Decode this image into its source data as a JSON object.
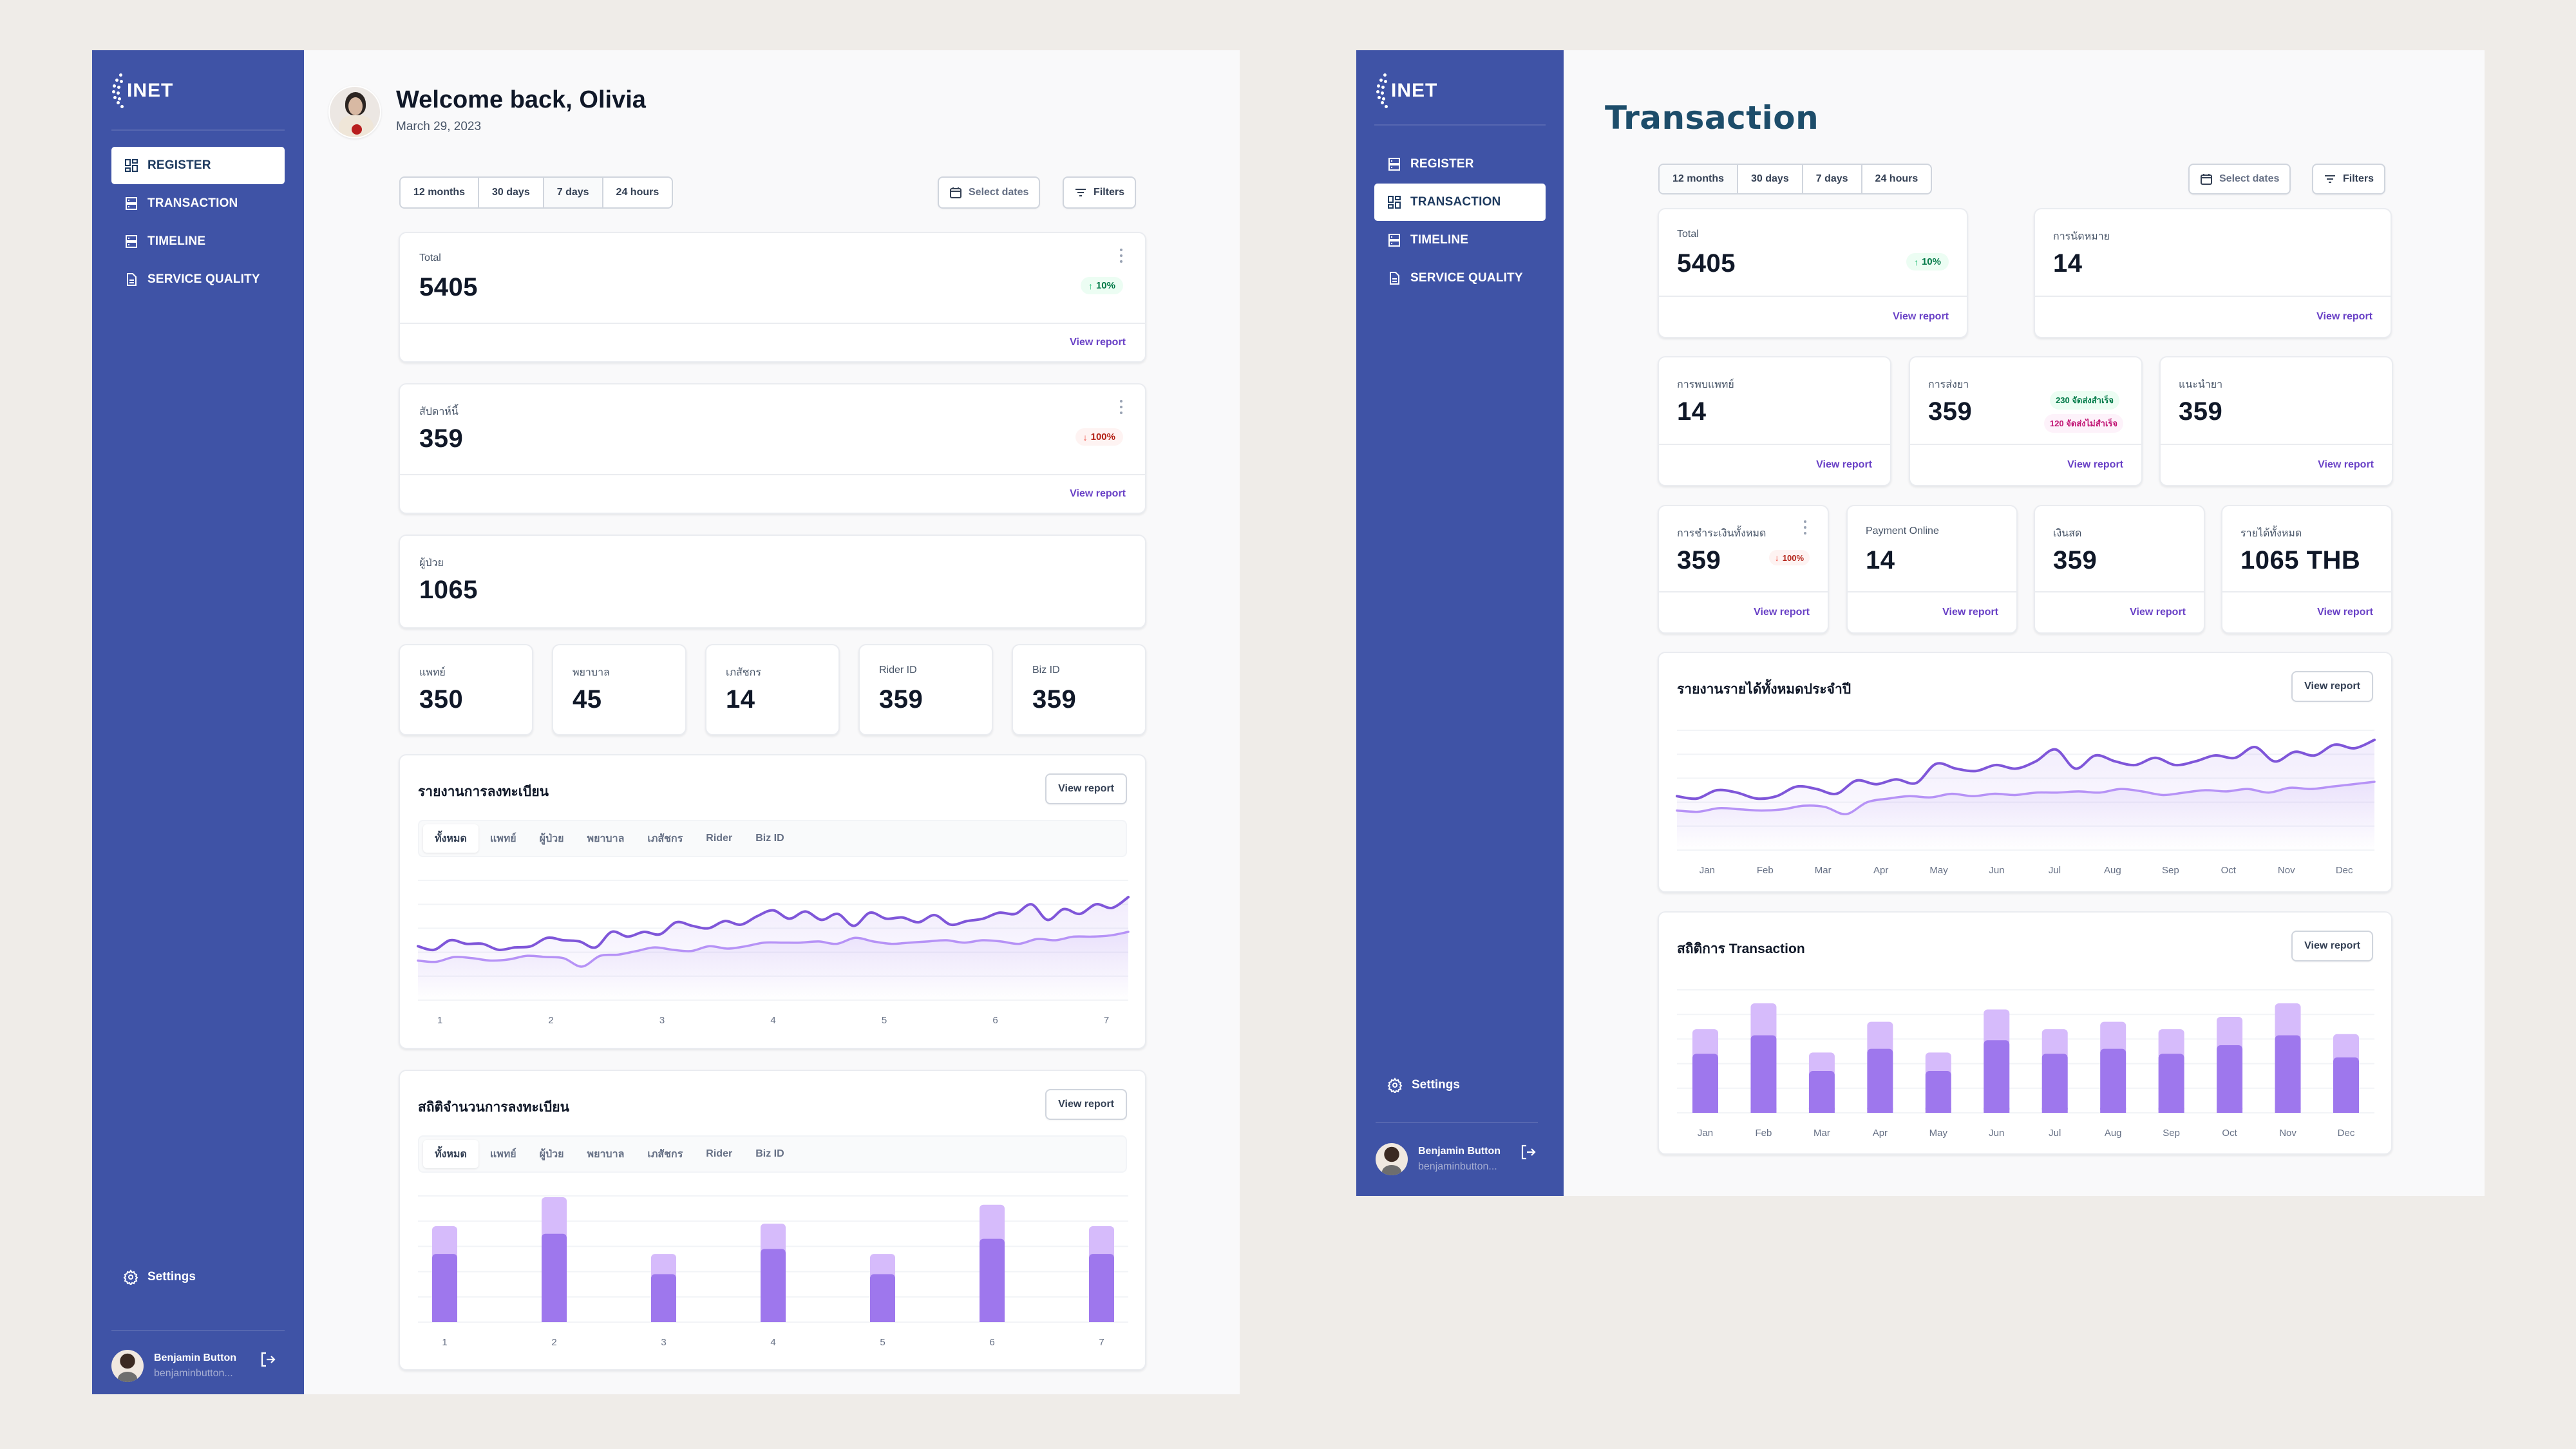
{
  "brand": {
    "logo_text": "INET",
    "sidebar_color": "#3F53A6",
    "accent": "#6941C6"
  },
  "nav": [
    {
      "label": "REGISTER",
      "icon": "grid-icon"
    },
    {
      "label": "TRANSACTION",
      "icon": "rows-icon"
    },
    {
      "label": "TIMELINE",
      "icon": "rows-icon"
    },
    {
      "label": "SERVICE QUALITY",
      "icon": "document-icon"
    }
  ],
  "settings_label": "Settings",
  "user": {
    "name": "Benjamin Button",
    "email": "benjaminbutton..."
  },
  "time_ranges": [
    "12 months",
    "30 days",
    "7 days",
    "24 hours"
  ],
  "select_dates_label": "Select dates",
  "filters_label": "Filters",
  "view_report": "View report",
  "register_page": {
    "active_nav": "REGISTER",
    "welcome": "Welcome back, Olivia",
    "date": "March 29, 2023",
    "active_range": "7 days",
    "stats": [
      {
        "label": "Total",
        "value": "5405",
        "badge": "10%",
        "trend": "up"
      },
      {
        "label": "สัปดาห์นี้",
        "value": "359",
        "badge": "100%",
        "trend": "down"
      },
      {
        "label": "ผู้ป่วย",
        "value": "1065"
      }
    ],
    "small_stats": [
      {
        "label": "แพทย์",
        "value": "350"
      },
      {
        "label": "พยาบาล",
        "value": "45"
      },
      {
        "label": "เภสัชกร",
        "value": "14"
      },
      {
        "label": "Rider ID",
        "value": "359"
      },
      {
        "label": "Biz ID",
        "value": "359"
      }
    ],
    "filter_tabs": [
      "ทั้งหมด",
      "แพทย์",
      "ผู้ป่วย",
      "พยาบาล",
      "เภสัชกร",
      "Rider",
      "Biz ID"
    ],
    "active_filter_tab": "ทั้งหมด"
  },
  "transaction_page": {
    "active_nav": "TRANSACTION",
    "title": "Transaction",
    "active_range": "12 months",
    "row1": [
      {
        "label": "Total",
        "value": "5405",
        "badge": "10%",
        "trend": "up"
      },
      {
        "label": "การนัดหมาย",
        "value": "14"
      }
    ],
    "row2": [
      {
        "label": "การพบแพทย์",
        "value": "14"
      },
      {
        "label": "การส่งยา",
        "value": "359",
        "badge_success": "230 จัดส่งสำเร็จ",
        "badge_fail": "120 จัดส่งไม่สำเร็จ"
      },
      {
        "label": "แนะนำยา",
        "value": "359"
      }
    ],
    "row3": [
      {
        "label": "การชำระเงินทั้งหมด",
        "value": "359",
        "badge": "100%",
        "trend": "down"
      },
      {
        "label": "Payment Online",
        "value": "14"
      },
      {
        "label": "เงินสด",
        "value": "359"
      },
      {
        "label": "รายได้ทั้งหมด",
        "value": "1065 THB"
      }
    ]
  },
  "chart_data": [
    {
      "type": "area",
      "title": "รายงานการลงทะเบียน",
      "x_ticks": [
        "1",
        "2",
        "3",
        "4",
        "5",
        "6",
        "7"
      ],
      "ylim": [
        0,
        100
      ],
      "grid": true,
      "series": [
        {
          "name": "primary",
          "color": "#7F56D9",
          "values": [
            45,
            42,
            50,
            47,
            47,
            42,
            44,
            45,
            52,
            50,
            49,
            44,
            57,
            53,
            57,
            55,
            65,
            62,
            60,
            66,
            63,
            70,
            75,
            68,
            74,
            67,
            72,
            62,
            73,
            68,
            69,
            65,
            71,
            63,
            66,
            68,
            73,
            72,
            80,
            67,
            76,
            72,
            80,
            77,
            86
          ]
        },
        {
          "name": "secondary",
          "color": "#B692F6",
          "values": [
            33,
            32,
            36,
            35,
            33,
            34,
            37,
            36,
            35,
            28,
            37,
            38,
            41,
            44,
            42,
            41,
            45,
            43,
            45,
            48,
            48,
            48,
            49,
            47,
            52,
            49,
            47,
            48,
            49,
            50,
            48,
            50,
            49,
            47,
            51,
            50,
            53,
            53,
            54,
            57
          ]
        }
      ]
    },
    {
      "type": "bar",
      "title": "สถิติจำนวนการลงทะเบียน",
      "categories": [
        "1",
        "2",
        "3",
        "4",
        "5",
        "6",
        "7"
      ],
      "ylim": [
        0,
        100
      ],
      "grid": true,
      "series": [
        {
          "name": "base",
          "color": "#9E77ED",
          "values": [
            54,
            70,
            38,
            58,
            38,
            66,
            54
          ]
        },
        {
          "name": "top",
          "color": "#D6BBFB",
          "values": [
            22,
            29,
            16,
            20,
            16,
            27,
            22
          ]
        }
      ]
    },
    {
      "type": "area",
      "title": "รายงานรายได้ทั้งหมดประจำปี",
      "x_ticks": [
        "Jan",
        "Feb",
        "Mar",
        "Apr",
        "May",
        "Jun",
        "Jul",
        "Aug",
        "Sep",
        "Oct",
        "Nov",
        "Dec"
      ],
      "ylim": [
        0,
        100
      ],
      "grid": true,
      "series": [
        {
          "name": "primary",
          "color": "#7F56D9",
          "values": [
            45,
            43,
            50,
            48,
            43,
            45,
            53,
            51,
            47,
            58,
            55,
            59,
            56,
            72,
            68,
            66,
            71,
            68,
            74,
            84,
            68,
            79,
            74,
            71,
            77,
            71,
            74,
            79,
            77,
            86,
            74,
            82,
            79,
            88,
            85,
            92
          ]
        },
        {
          "name": "secondary",
          "color": "#B692F6",
          "values": [
            33,
            32,
            35,
            34,
            33,
            34,
            37,
            36,
            30,
            40,
            43,
            45,
            44,
            47,
            45,
            47,
            46,
            48,
            48,
            49,
            48,
            51,
            49,
            46,
            48,
            50,
            49,
            51,
            48,
            52,
            51,
            53,
            55,
            57
          ]
        }
      ]
    },
    {
      "type": "bar",
      "title": "สถิติการ Transaction",
      "categories": [
        "Jan",
        "Feb",
        "Mar",
        "Apr",
        "May",
        "Jun",
        "Jul",
        "Aug",
        "Sep",
        "Oct",
        "Nov",
        "Dec"
      ],
      "ylim": [
        0,
        100
      ],
      "grid": true,
      "series": [
        {
          "name": "base",
          "color": "#9E77ED",
          "values": [
            48,
            63,
            34,
            52,
            34,
            59,
            48,
            52,
            48,
            55,
            63,
            45
          ]
        },
        {
          "name": "top",
          "color": "#D6BBFB",
          "values": [
            20,
            26,
            15,
            22,
            15,
            25,
            20,
            22,
            20,
            23,
            26,
            19
          ]
        }
      ]
    }
  ]
}
